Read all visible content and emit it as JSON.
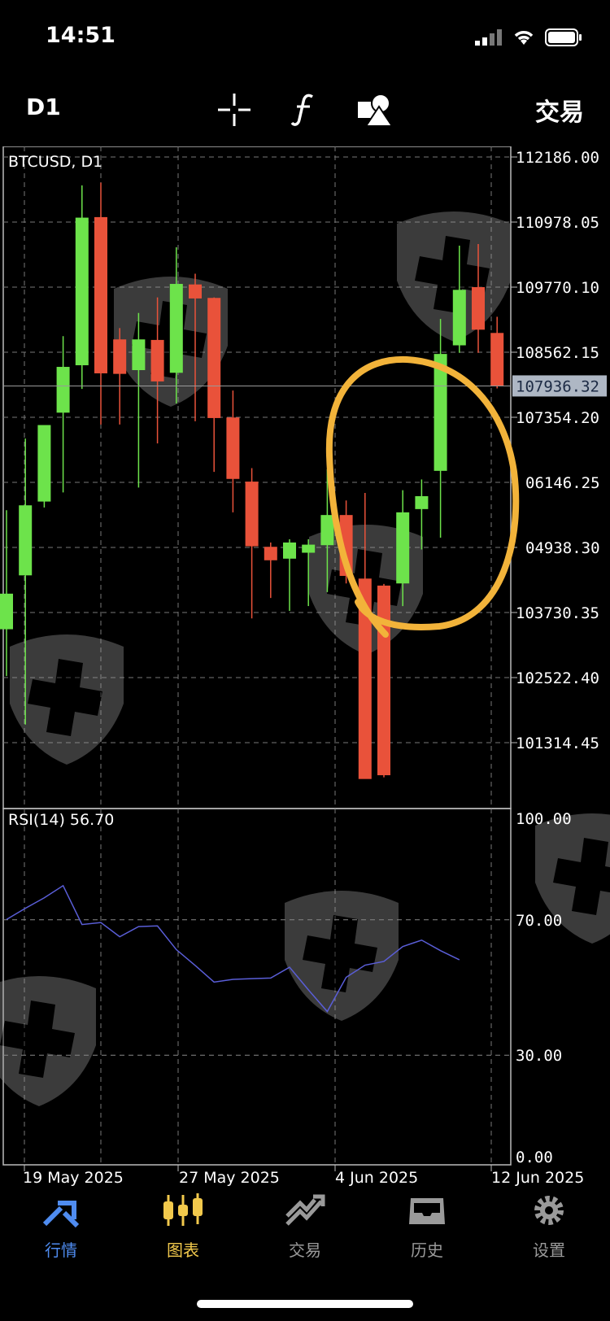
{
  "status_bar": {
    "time": "14:51"
  },
  "toolbar": {
    "period": "D1",
    "trade_label": "交易",
    "icons": [
      "crosshair-icon",
      "function-icon",
      "objects-icon"
    ]
  },
  "chart_data": [
    {
      "type": "candlestick",
      "title": "BTCUSD, D1",
      "current_price": "107936.32",
      "current_price_value": 107936.32,
      "ylim": [
        100200,
        112400
      ],
      "y_ticks": [
        "112186.00",
        "110978.05",
        "109770.10",
        "108562.15",
        "107354.20",
        "06146.25",
        "04938.30",
        "103730.35",
        "102522.40",
        "101314.45"
      ],
      "y_tick_values": [
        112186.0,
        110978.05,
        109770.1,
        108562.15,
        107354.2,
        106146.25,
        104938.3,
        103730.35,
        102522.4,
        101314.45
      ],
      "x_labels": [
        "19 May 2025",
        "27 May 2025",
        "4 Jun 2025",
        "12 Jun 2025"
      ],
      "colors": {
        "up": "#6de34b",
        "down": "#e9523a"
      },
      "candles": [
        {
          "o": 103420,
          "h": 105630,
          "l": 102550,
          "c": 104080
        },
        {
          "o": 104420,
          "h": 106960,
          "l": 101650,
          "c": 105720
        },
        {
          "o": 105790,
          "h": 107030,
          "l": 105680,
          "c": 107210
        },
        {
          "o": 107440,
          "h": 108860,
          "l": 105960,
          "c": 108290
        },
        {
          "o": 108320,
          "h": 111660,
          "l": 107880,
          "c": 111060
        },
        {
          "o": 111070,
          "h": 111710,
          "l": 107220,
          "c": 108170
        },
        {
          "o": 108800,
          "h": 109010,
          "l": 107220,
          "c": 108160
        },
        {
          "o": 108230,
          "h": 109290,
          "l": 106050,
          "c": 108800
        },
        {
          "o": 108790,
          "h": 109580,
          "l": 106870,
          "c": 108020
        },
        {
          "o": 108180,
          "h": 110510,
          "l": 107610,
          "c": 109830
        },
        {
          "o": 109820,
          "h": 110020,
          "l": 107280,
          "c": 109560
        },
        {
          "o": 109570,
          "h": 109580,
          "l": 106340,
          "c": 107340
        },
        {
          "o": 107350,
          "h": 107850,
          "l": 105590,
          "c": 106210
        },
        {
          "o": 106160,
          "h": 106410,
          "l": 103620,
          "c": 104960
        },
        {
          "o": 104950,
          "h": 105030,
          "l": 104000,
          "c": 104700
        },
        {
          "o": 104730,
          "h": 105090,
          "l": 103760,
          "c": 105030
        },
        {
          "o": 104840,
          "h": 105090,
          "l": 103850,
          "c": 104990
        },
        {
          "o": 104980,
          "h": 106390,
          "l": 104110,
          "c": 105540
        },
        {
          "o": 105540,
          "h": 105810,
          "l": 104270,
          "c": 104410
        },
        {
          "o": 104360,
          "h": 105950,
          "l": 100660,
          "c": 100640
        },
        {
          "o": 104230,
          "h": 104260,
          "l": 100670,
          "c": 100710
        },
        {
          "o": 104270,
          "h": 106000,
          "l": 103850,
          "c": 105590
        },
        {
          "o": 105650,
          "h": 106200,
          "l": 104900,
          "c": 105890
        },
        {
          "o": 106360,
          "h": 109180,
          "l": 105120,
          "c": 108530
        },
        {
          "o": 108690,
          "h": 110540,
          "l": 108550,
          "c": 109720
        },
        {
          "o": 109770,
          "h": 110570,
          "l": 108550,
          "c": 108980
        },
        {
          "o": 108920,
          "h": 109220,
          "l": 107890,
          "c": 107940
        }
      ]
    },
    {
      "type": "line",
      "title": "RSI(14) 56.70",
      "ylim": [
        0,
        100
      ],
      "y_ticks": [
        "100.00",
        "70.00",
        "30.00",
        "0.00"
      ],
      "y_tick_values": [
        100,
        70,
        30,
        0
      ],
      "series": [
        {
          "values": [
            70.1,
            73.4,
            76.5,
            80.1,
            68.6,
            69.2,
            65.0,
            68.0,
            68.2,
            61.2,
            56.5,
            51.6,
            52.4,
            52.6,
            52.8,
            56.0,
            49.3,
            42.9,
            53.0,
            56.6,
            57.7,
            62.1,
            64.0,
            60.9,
            58.2
          ]
        }
      ],
      "color": "#5a5ed8"
    }
  ],
  "tabbar": {
    "items": [
      {
        "label": "行情",
        "color": "#4f8cf0"
      },
      {
        "label": "图表",
        "color": "#f2c94c"
      },
      {
        "label": "交易",
        "color": "#9a9a9a"
      },
      {
        "label": "历史",
        "color": "#9a9a9a"
      },
      {
        "label": "设置",
        "color": "#9a9a9a"
      }
    ]
  }
}
